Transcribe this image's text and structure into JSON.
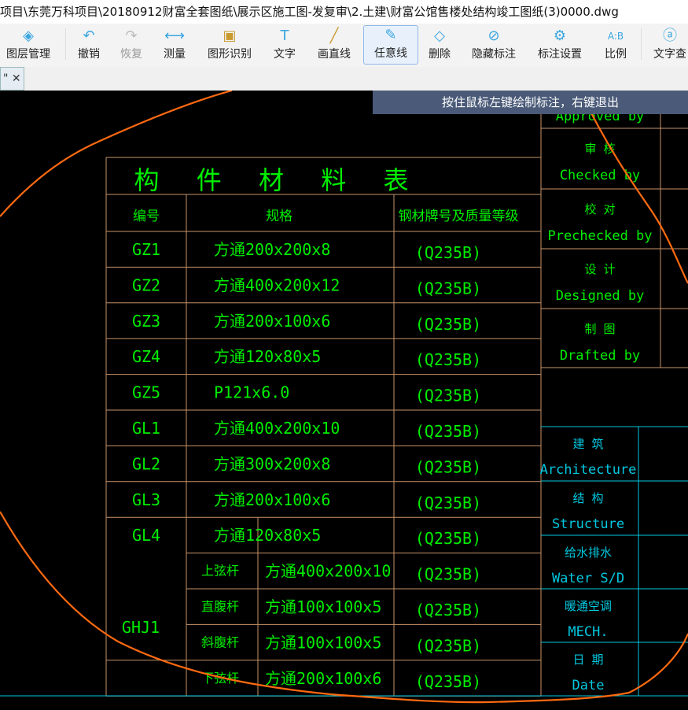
{
  "window": {
    "title": "项目\\东莞万科项目\\20180912财富全套图纸\\展示区施工图-发复审\\2.土建\\财富公馆售楼处结构竣工图纸(3)0000.dwg"
  },
  "toolbar": {
    "items": [
      {
        "label": "图层管理",
        "icon": "layers-icon"
      },
      {
        "label": "撤销",
        "icon": "undo-icon"
      },
      {
        "label": "恢复",
        "icon": "redo-icon"
      },
      {
        "label": "测量",
        "icon": "ruler-icon"
      },
      {
        "label": "图形识别",
        "icon": "shape-recognize-icon"
      },
      {
        "label": "文字",
        "icon": "text-icon"
      },
      {
        "label": "画直线",
        "icon": "line-icon"
      },
      {
        "label": "任意线",
        "icon": "pen-icon"
      },
      {
        "label": "删除",
        "icon": "eraser-icon"
      },
      {
        "label": "隐藏标注",
        "icon": "eye-hide-icon"
      },
      {
        "label": "标注设置",
        "icon": "annotation-settings-icon"
      },
      {
        "label": "比例",
        "icon": "scale-icon"
      },
      {
        "label": "文字查",
        "icon": "text-search-icon"
      }
    ]
  },
  "tab": {
    "label": "\"",
    "close": "✕"
  },
  "tooltip": "按住鼠标左键绘制标注，右键退出",
  "colors": {
    "table_line": "#c8946a",
    "text": "#00ee00",
    "cyan": "#00c8e0",
    "curve": "#ff6a10"
  },
  "table": {
    "title": "构 件 材 料 表",
    "headers": [
      "编号",
      "规格",
      "钢材牌号及质量等级"
    ],
    "rows": [
      {
        "id": "GZ1",
        "spec": "方通200x200x8",
        "grade": "(Q235B)"
      },
      {
        "id": "GZ2",
        "spec": "方通400x200x12",
        "grade": "(Q235B)"
      },
      {
        "id": "GZ3",
        "spec": "方通200x100x6",
        "grade": "(Q235B)"
      },
      {
        "id": "GZ4",
        "spec": "方通120x80x5",
        "grade": "(Q235B)"
      },
      {
        "id": "GZ5",
        "spec": "P121x6.0",
        "grade": "(Q235B)"
      },
      {
        "id": "GL1",
        "spec": "方通400x200x10",
        "grade": "(Q235B)"
      },
      {
        "id": "GL2",
        "spec": "方通300x200x8",
        "grade": "(Q235B)"
      },
      {
        "id": "GL3",
        "spec": "方通200x100x6",
        "grade": "(Q235B)"
      },
      {
        "id": "GL4",
        "spec": "方通120x80x5",
        "grade": "(Q235B)"
      }
    ],
    "truss": {
      "id": "GHJ1",
      "rows": [
        {
          "part": "上弦杆",
          "spec": "方通400x200x10",
          "grade": "(Q235B)"
        },
        {
          "part": "直腹杆",
          "spec": "方通100x100x5",
          "grade": "(Q235B)"
        },
        {
          "part": "斜腹杆",
          "spec": "方通100x100x5",
          "grade": "(Q235B)"
        },
        {
          "part": "下弦杆",
          "spec": "方通200x100x6",
          "grade": "(Q235B)"
        }
      ]
    }
  },
  "signoff": [
    {
      "cn": "",
      "en": "Approved by"
    },
    {
      "cn": "审  核",
      "en": "Checked by"
    },
    {
      "cn": "校  对",
      "en": "Prechecked by"
    },
    {
      "cn": "设  计",
      "en": "Designed by"
    },
    {
      "cn": "制  图",
      "en": "Drafted by"
    }
  ],
  "disciplines": [
    {
      "cn": "建  筑",
      "en": "Architecture"
    },
    {
      "cn": "结  构",
      "en": "Structure"
    },
    {
      "cn": "给水排水",
      "en": "Water S/D"
    },
    {
      "cn": "暖通空调",
      "en": "MECH."
    },
    {
      "cn": "日  期",
      "en": "Date"
    }
  ]
}
